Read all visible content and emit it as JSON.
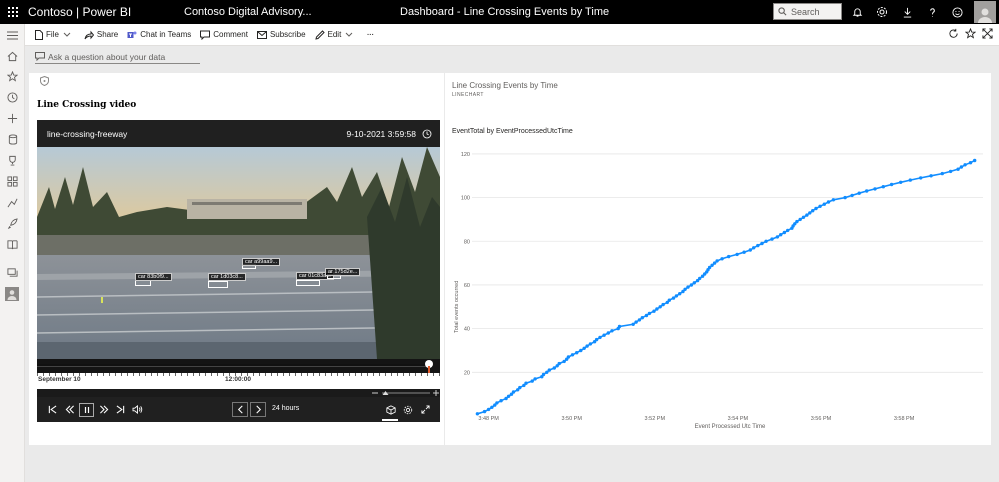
{
  "app": {
    "brand": "Contoso | Power BI",
    "workspace": "Contoso Digital Advisory...",
    "title": "Dashboard - Line Crossing Events by Time",
    "search_placeholder": "Search"
  },
  "actions": {
    "file": "File",
    "share": "Share",
    "chat": "Chat in Teams",
    "comment": "Comment",
    "subscribe": "Subscribe",
    "edit": "Edit",
    "more": "···"
  },
  "qna": {
    "placeholder": "Ask a question about your data"
  },
  "video_tile": {
    "heading": "Line Crossing video",
    "camera_name": "line-crossing-freeway",
    "timestamp": "9-10-2021 3:59:58",
    "detections": [
      "car 83b0f9...",
      "car 1d03c8...",
      "car a99aa9...",
      "car 01c83a...",
      "ar 175d2e..."
    ],
    "timeline_date": "September 10",
    "timeline_noon": "12:00:00",
    "range": "24 hours"
  },
  "chart_tile": {
    "title": "Line Crossing Events by Time",
    "subtitle": "LINECHART"
  },
  "chart_data": {
    "type": "line",
    "title": "EventTotal by EventProcessedUtcTime",
    "xlabel": "Event Processed Utc Time",
    "ylabel": "Total events occurred",
    "x_ticks": [
      "3:48 PM",
      "3:50 PM",
      "3:52 PM",
      "3:54 PM",
      "3:56 PM",
      "3:58 PM"
    ],
    "x_tick_minutes": [
      48,
      50,
      52,
      54,
      56,
      58
    ],
    "xlim_minutes": [
      47.6,
      59.9
    ],
    "y_ticks": [
      20,
      40,
      60,
      80,
      100,
      120
    ],
    "ylim": [
      0,
      125
    ],
    "grid": true,
    "color": "#118DFF",
    "series": [
      {
        "minute": [
          47.73,
          47.9,
          48.0,
          48.08,
          48.15,
          48.2,
          48.3,
          48.42,
          48.48,
          48.55,
          48.6,
          48.7,
          48.75,
          48.85,
          48.9,
          49.05,
          49.12,
          49.28,
          49.32,
          49.4,
          49.46,
          49.58,
          49.65,
          49.7,
          49.82,
          49.88,
          49.92,
          50.02,
          50.12,
          50.22,
          50.3,
          50.37,
          50.45,
          50.55,
          50.6,
          50.68,
          50.78,
          50.88,
          50.97,
          51.12,
          51.15,
          51.48,
          51.55,
          51.63,
          51.7,
          51.8,
          51.87,
          51.98,
          52.05,
          52.13,
          52.2,
          52.3,
          52.35,
          52.45,
          52.52,
          52.6,
          52.68,
          52.73,
          52.8,
          52.88,
          52.95,
          53.03,
          53.08,
          53.15,
          53.2,
          53.25,
          53.28,
          53.32,
          53.38,
          53.44,
          53.5,
          53.62,
          53.78,
          53.98,
          54.15,
          54.3,
          54.38,
          54.48,
          54.58,
          54.68,
          54.82,
          54.95,
          55.03,
          55.12,
          55.2,
          55.3,
          55.33,
          55.37,
          55.42,
          55.5,
          55.58,
          55.66,
          55.73,
          55.8,
          55.88,
          55.98,
          56.08,
          56.18,
          56.3,
          56.58,
          56.75,
          56.92,
          57.1,
          57.3,
          57.5,
          57.7,
          57.92,
          58.15,
          58.4,
          58.65,
          58.92,
          59.12,
          59.3,
          59.38,
          59.47,
          59.6,
          59.7
        ],
        "total": [
          1,
          2,
          3,
          4,
          5,
          6,
          7,
          8,
          9,
          10,
          11,
          12,
          13,
          14,
          15,
          16,
          17,
          18,
          19,
          20,
          21,
          22,
          23,
          24,
          25,
          26,
          27,
          28,
          29,
          30,
          31,
          32,
          33,
          34,
          35,
          36,
          37,
          38,
          39,
          40,
          41,
          42,
          43,
          44,
          45,
          46,
          47,
          48,
          49,
          50,
          51,
          52,
          53,
          54,
          55,
          56,
          57,
          58,
          59,
          60,
          61,
          62,
          63,
          64,
          65,
          66,
          67,
          68,
          69,
          70,
          71,
          72,
          73,
          74,
          75,
          76,
          77,
          78,
          79,
          80,
          81,
          82,
          83,
          84,
          85,
          86,
          87,
          88,
          89,
          90,
          91,
          92,
          93,
          94,
          95,
          96,
          97,
          98,
          99,
          100,
          101,
          102,
          103,
          104,
          105,
          106,
          107,
          108,
          109,
          110,
          111,
          112,
          113,
          114,
          115,
          116,
          117
        ]
      }
    ]
  }
}
